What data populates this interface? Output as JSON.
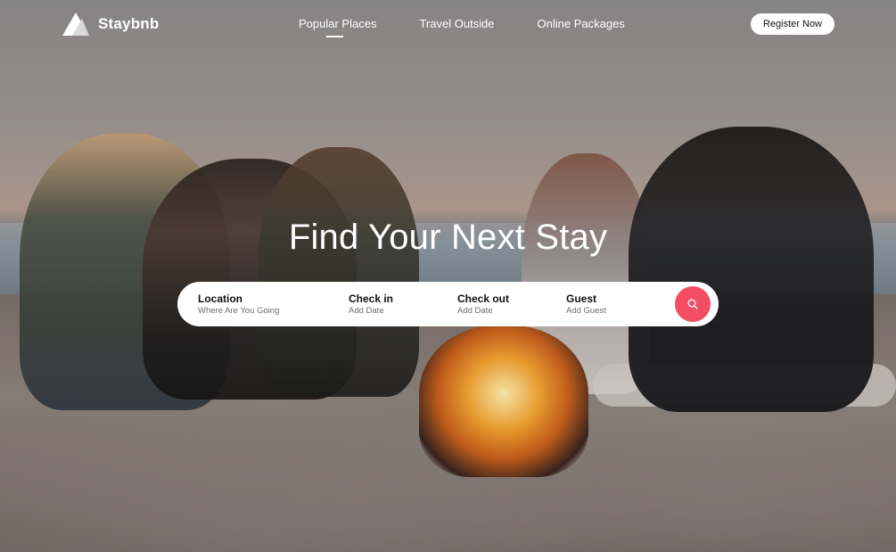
{
  "brand": {
    "name": "Staybnb"
  },
  "nav": {
    "links": [
      {
        "label": "Popular Places",
        "active": true
      },
      {
        "label": "Travel Outside",
        "active": false
      },
      {
        "label": "Online Packages",
        "active": false
      }
    ],
    "register_label": "Register Now"
  },
  "hero": {
    "title": "Find Your Next Stay"
  },
  "search": {
    "fields": [
      {
        "label": "Location",
        "hint": "Where Are You Going"
      },
      {
        "label": "Check in",
        "hint": "Add Date"
      },
      {
        "label": "Check out",
        "hint": "Add Date"
      },
      {
        "label": "Guest",
        "hint": "Add Guest"
      }
    ],
    "button_icon": "search-icon"
  },
  "colors": {
    "accent": "#f24d63",
    "text_dark": "#111111"
  }
}
